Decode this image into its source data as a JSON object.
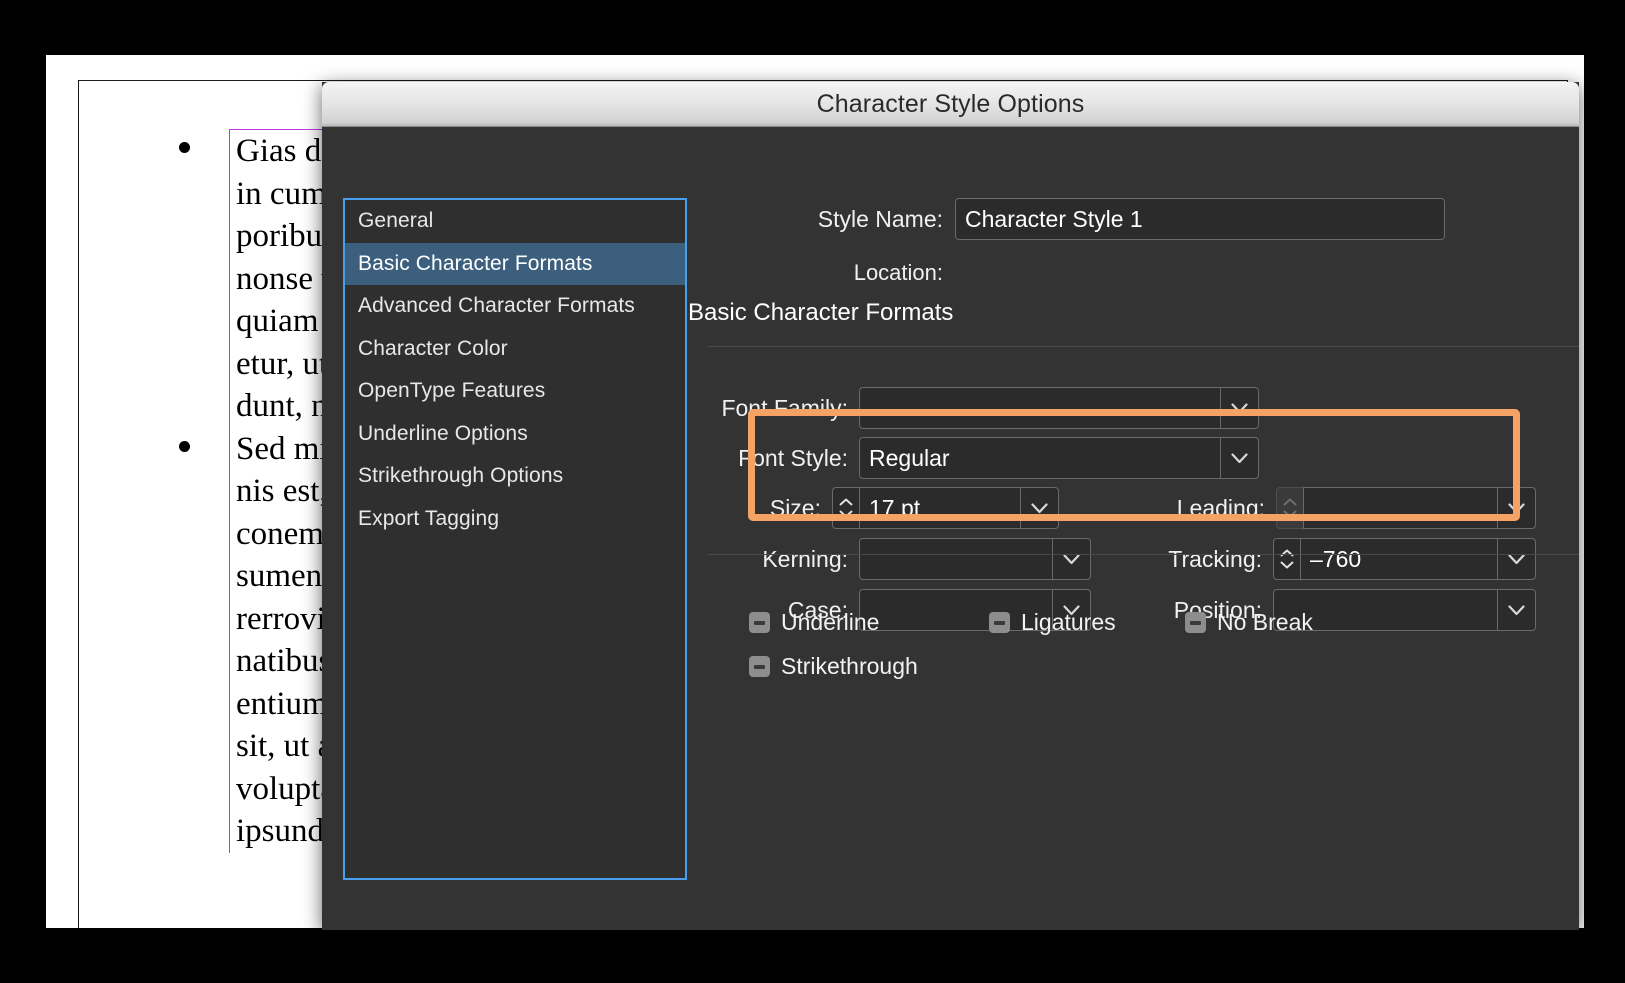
{
  "document": {
    "bullets": [
      "Gias dolo\nin cum au\nporibus e\nnonse vol\nquiam iso\netur, ut qu\ndunt, non",
      "Sed mil in\nnis est, vo\nconemqu\nsumenim\nrerrovide\nnatibus a\nentium q\nsit, ut aut\nvolupta q\nipsundita"
    ]
  },
  "dialog": {
    "title": "Character Style Options",
    "nav": {
      "items": [
        {
          "label": "General",
          "selected": false
        },
        {
          "label": "Basic Character Formats",
          "selected": true
        },
        {
          "label": "Advanced Character Formats",
          "selected": false
        },
        {
          "label": "Character Color",
          "selected": false
        },
        {
          "label": "OpenType Features",
          "selected": false
        },
        {
          "label": "Underline Options",
          "selected": false
        },
        {
          "label": "Strikethrough Options",
          "selected": false
        },
        {
          "label": "Export Tagging",
          "selected": false
        }
      ]
    },
    "style_name_label": "Style Name:",
    "style_name_value": "Character Style 1",
    "location_label": "Location:",
    "location_value": "",
    "section_heading": "Basic Character Formats",
    "fields": {
      "font_family_label": "Font Family:",
      "font_family_value": "",
      "font_style_label": "Font Style:",
      "font_style_value": "Regular",
      "size_label": "Size:",
      "size_value": "17 pt",
      "leading_label": "Leading:",
      "leading_value": "",
      "kerning_label": "Kerning:",
      "kerning_value": "",
      "tracking_label": "Tracking:",
      "tracking_value": "–760",
      "case_label": "Case:",
      "case_value": "",
      "position_label": "Position:",
      "position_value": ""
    },
    "checkboxes": [
      {
        "label": "Underline",
        "state": "mixed"
      },
      {
        "label": "Ligatures",
        "state": "mixed"
      },
      {
        "label": "No Break",
        "state": "mixed"
      },
      {
        "label": "Strikethrough",
        "state": "mixed"
      }
    ],
    "highlight": {
      "color": "#f5a365",
      "fields": [
        "Size:",
        "Leading:",
        "Kerning:",
        "Tracking:"
      ]
    }
  },
  "colors": {
    "dialog_background": "#333333",
    "nav_selected": "#3c5f7e",
    "focus_ring": "#4a9eef",
    "highlight_orange": "#f5a365",
    "text_frame_outline": "#c03ce0"
  }
}
